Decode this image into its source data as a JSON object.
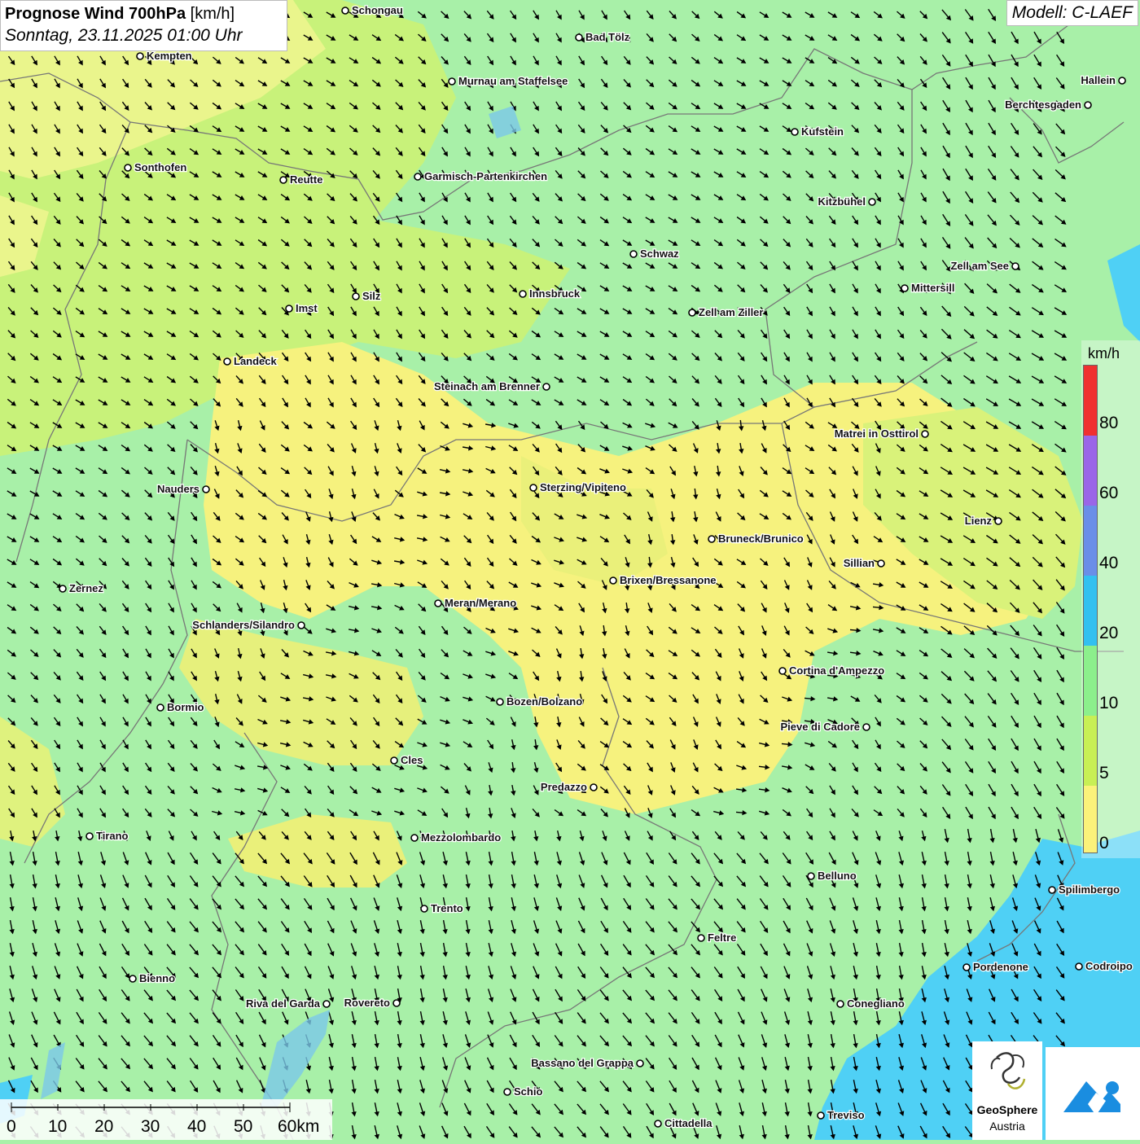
{
  "title": {
    "main": "Prognose Wind 700hPa",
    "unit": "[km/h]",
    "datetime": "Sonntag, 23.11.2025 01:00 Uhr"
  },
  "model": "Modell: C-LAEF",
  "legend": {
    "unit": "km/h",
    "labels": [
      "80",
      "60",
      "40",
      "20",
      "10",
      "5",
      "0"
    ],
    "colors": [
      "#f03030",
      "#9a66e8",
      "#6a8ee8",
      "#33c0f0",
      "#8cef8c",
      "#c8ef55",
      "#fbf27a"
    ]
  },
  "scalebar": {
    "labels": [
      "0",
      "10",
      "20",
      "30",
      "40",
      "50",
      "60km"
    ]
  },
  "logo": {
    "line1": "GeoSphere",
    "line2": "Austria"
  },
  "cities": [
    {
      "name": "Schongau"
    },
    {
      "name": "Bad Tölz"
    },
    {
      "name": "Kempten"
    },
    {
      "name": "Murnau am Staffelsee"
    },
    {
      "name": "Hallein"
    },
    {
      "name": "Berchtesgaden"
    },
    {
      "name": "Kufstein"
    },
    {
      "name": "Sonthofen"
    },
    {
      "name": "Reutte"
    },
    {
      "name": "Garmisch-Partenkirchen"
    },
    {
      "name": "Kitzbühel"
    },
    {
      "name": "Schwaz"
    },
    {
      "name": "Zell am See"
    },
    {
      "name": "Mittersill"
    },
    {
      "name": "Innsbruck"
    },
    {
      "name": "Silz"
    },
    {
      "name": "Imst"
    },
    {
      "name": "Zell am Ziller"
    },
    {
      "name": "Landeck"
    },
    {
      "name": "Steinach am Brenner"
    },
    {
      "name": "Matrei in Osttirol"
    },
    {
      "name": "Nauders"
    },
    {
      "name": "Sterzing/Vipiteno"
    },
    {
      "name": "Lienz"
    },
    {
      "name": "Bruneck/Brunico"
    },
    {
      "name": "Sillian"
    },
    {
      "name": "Zernez"
    },
    {
      "name": "Brixen/Bressanone"
    },
    {
      "name": "Meran/Merano"
    },
    {
      "name": "Schlanders/Silandro"
    },
    {
      "name": "Cortina d'Ampezzo"
    },
    {
      "name": "Bozen/Bolzano"
    },
    {
      "name": "Bormio"
    },
    {
      "name": "Pieve di Cadore"
    },
    {
      "name": "Cles"
    },
    {
      "name": "Predazzo"
    },
    {
      "name": "Tirano"
    },
    {
      "name": "Mezzolombardo"
    },
    {
      "name": "Belluno"
    },
    {
      "name": "Spilimbergo"
    },
    {
      "name": "Trento"
    },
    {
      "name": "Feltre"
    },
    {
      "name": "Pordenone"
    },
    {
      "name": "Codroipo"
    },
    {
      "name": "Bienno"
    },
    {
      "name": "Riva del Garda"
    },
    {
      "name": "Rovereto"
    },
    {
      "name": "Conegliano"
    },
    {
      "name": "Bassano del Grappa"
    },
    {
      "name": "Schio"
    },
    {
      "name": "Treviso"
    },
    {
      "name": "Cittadella"
    }
  ]
}
